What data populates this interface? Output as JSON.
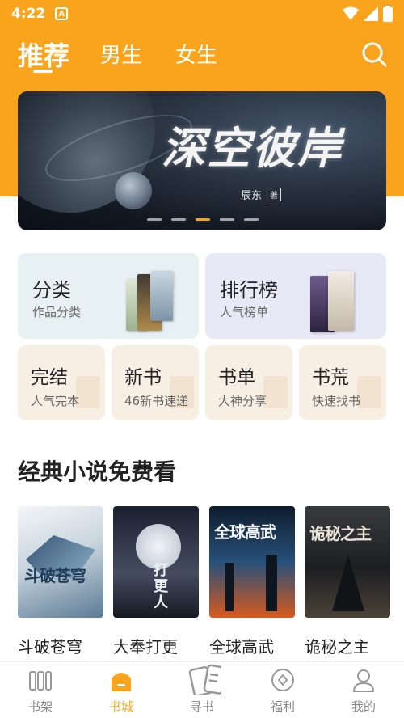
{
  "status_bar": {
    "time": "4:22",
    "app_badge": "A"
  },
  "top_tabs": [
    {
      "label": "推荐",
      "active": true
    },
    {
      "label": "男生",
      "active": false
    },
    {
      "label": "女生",
      "active": false
    }
  ],
  "banner": {
    "title": "深空彼岸",
    "author": "辰东",
    "author_tag": "著",
    "page_count": 5,
    "active_page": 3
  },
  "categories_large": [
    {
      "title": "分类",
      "subtitle": "作品分类"
    },
    {
      "title": "排行榜",
      "subtitle": "人气榜单"
    }
  ],
  "categories_small": [
    {
      "title": "完结",
      "subtitle": "人气完本"
    },
    {
      "title": "新书",
      "subtitle": "46新书速递"
    },
    {
      "title": "书单",
      "subtitle": "大神分享"
    },
    {
      "title": "书荒",
      "subtitle": "快速找书"
    }
  ],
  "section": {
    "title": "经典小说免费看",
    "books": [
      {
        "name": "斗破苍穹",
        "cover_text": "斗破苍穹"
      },
      {
        "name": "大奉打更",
        "cover_text": "打更人"
      },
      {
        "name": "全球高武",
        "cover_text": "全球高武"
      },
      {
        "name": "诡秘之主",
        "cover_text": "诡秘之主"
      }
    ]
  },
  "bottom_nav": [
    {
      "label": "书架",
      "icon": "bookshelf-icon",
      "active": false
    },
    {
      "label": "书城",
      "icon": "bookstore-icon",
      "active": true
    },
    {
      "label": "寻书",
      "icon": "find-book-icon",
      "active": false
    },
    {
      "label": "福利",
      "icon": "welfare-icon",
      "active": false
    },
    {
      "label": "我的",
      "icon": "profile-icon",
      "active": false
    }
  ],
  "colors": {
    "accent": "#f9a41c",
    "text": "#222222",
    "subtext": "#666666",
    "nav_inactive": "#888888"
  }
}
